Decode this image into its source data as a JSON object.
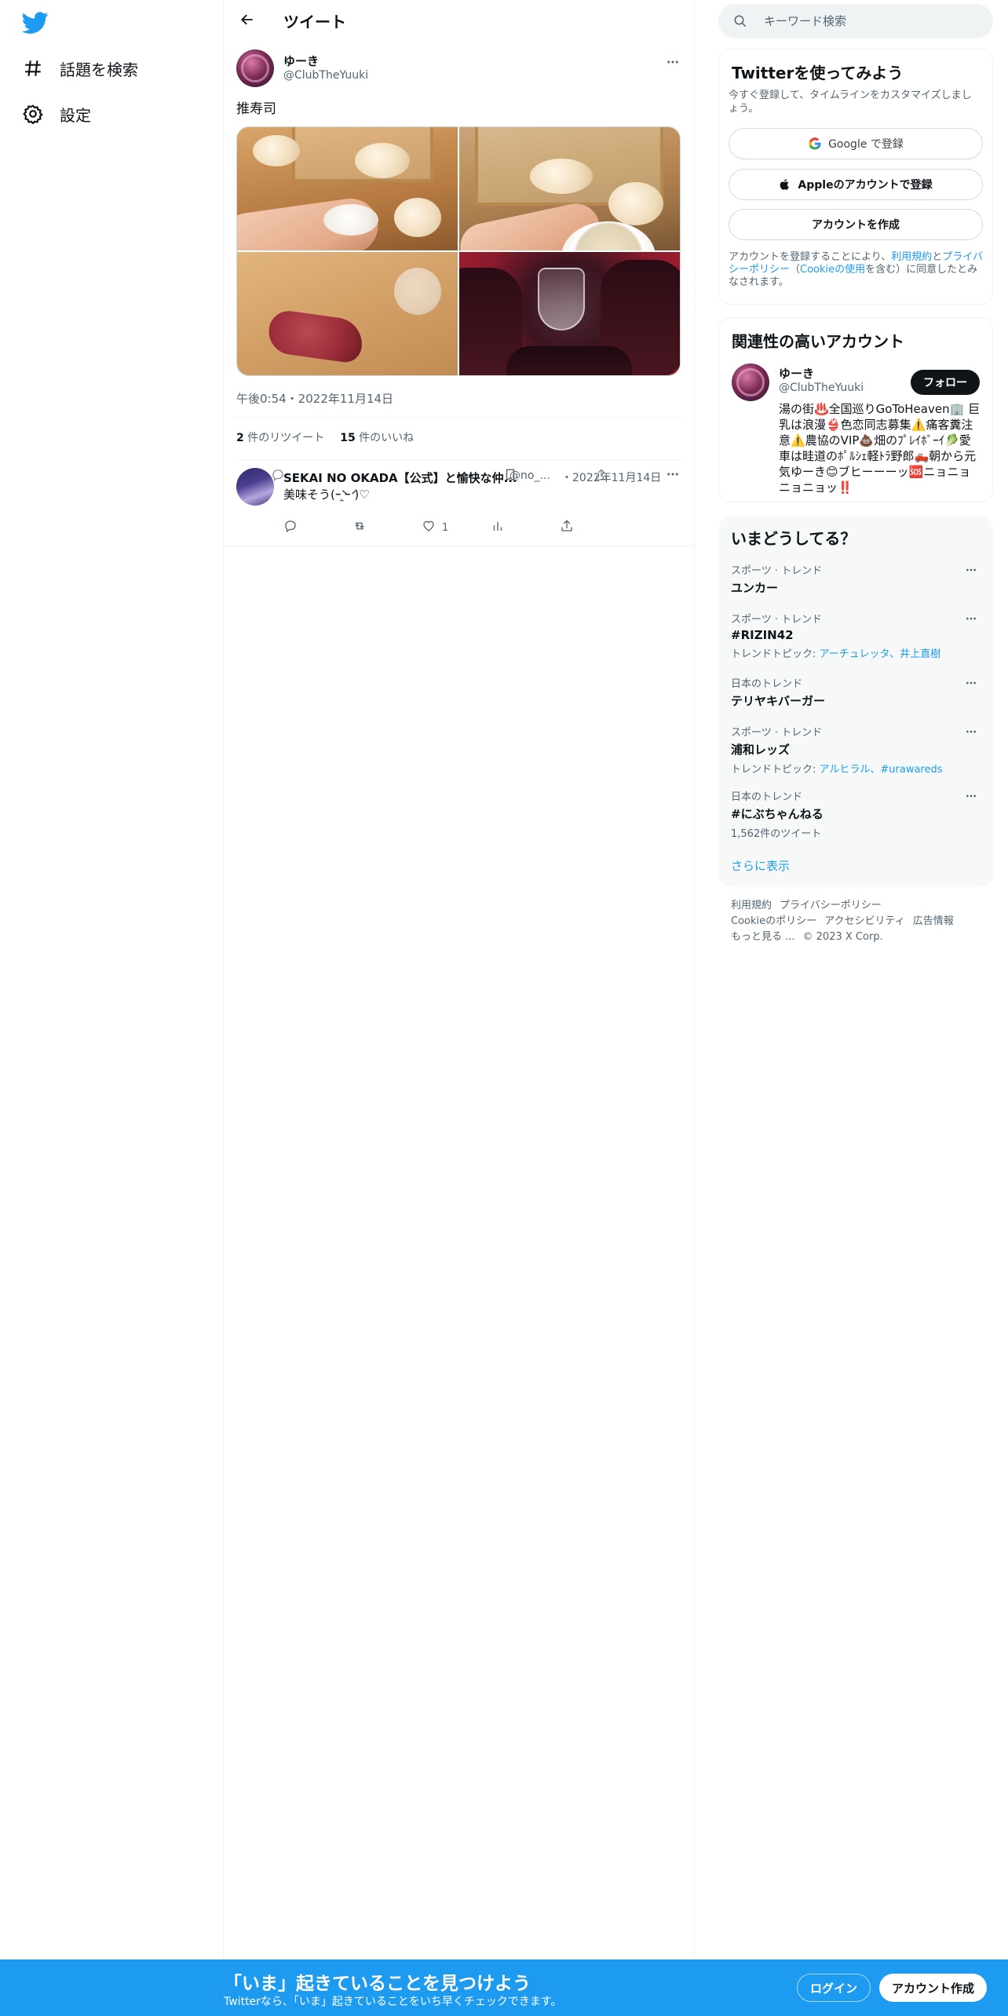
{
  "nav": {
    "explore_label": "話題を検索",
    "settings_label": "設定"
  },
  "header": {
    "title": "ツイート"
  },
  "tweet": {
    "author_name": "ゆーき",
    "author_handle": "@ClubTheYuuki",
    "text": "推寿司",
    "timestamp": "午後0:54・2022年11月14日",
    "retweets_count": "2",
    "retweets_label": "件のリツイート",
    "likes_count": "15",
    "likes_label": "件のいいね"
  },
  "reply": {
    "name": "SEKAI NO OKADA【公式】と愉快な仲...",
    "handle": "@no_...",
    "date": "・2022年11月14日",
    "text": "美味そう(ｰ̀ ̯ｰ́ )♡",
    "likes": "1"
  },
  "search": {
    "placeholder": "キーワード検索"
  },
  "signup": {
    "title": "Twitterを使ってみよう",
    "subtitle": "今すぐ登録して、タイムラインをカスタマイズしましょう。",
    "google_label": "Google で登録",
    "apple_label": "Appleのアカウントで登録",
    "create_label": "アカウントを作成",
    "terms_prefix": "アカウントを登録することにより、",
    "terms_link": "利用規約",
    "terms_and": "と",
    "privacy_link": "プライバシーポリシー",
    "terms_paren_open": "（",
    "cookie_link": "Cookieの使用",
    "terms_suffix": "を含む）に同意したとみなされます。"
  },
  "related": {
    "title": "関連性の高いアカウント",
    "name": "ゆーき",
    "handle": "@ClubTheYuuki",
    "follow_label": "フォロー",
    "bio": "湯の街♨️全国巡りGoToHeaven🏢 巨乳は浪漫👙色恋同志募集⚠️痛客糞注意⚠️農協のVIP💩畑のﾌﾟﾚｲﾎﾞｰｲ🥬愛車は畦道のﾎﾟﾙｼｪ軽ﾄﾗ野郎🛻朝から元気ゆーき😊ブヒーーーッ🆘ニョニョニョニョッ‼️"
  },
  "trends": {
    "title": "いまどうしてる？",
    "items": [
      {
        "context": "スポーツ · トレンド",
        "topic": "ユンカー",
        "extra_prefix": "",
        "extra_links": ""
      },
      {
        "context": "スポーツ · トレンド",
        "topic": "#RIZIN42",
        "extra_prefix": "トレンドトピック: ",
        "extra_links": "アーチュレッタ、井上直樹"
      },
      {
        "context": "日本のトレンド",
        "topic": "テリヤキバーガー",
        "extra_prefix": "",
        "extra_links": ""
      },
      {
        "context": "スポーツ · トレンド",
        "topic": "浦和レッズ",
        "extra_prefix": "トレンドトピック: ",
        "extra_links": "アルヒラル、#urawareds"
      },
      {
        "context": "日本のトレンド",
        "topic": "#にぶちゃんねる",
        "extra_prefix": "1,562件のツイート",
        "extra_links": ""
      }
    ],
    "show_more": "さらに表示"
  },
  "footer": {
    "links": [
      "利用規約",
      "プライバシーポリシー",
      "Cookieのポリシー",
      "アクセシビリティ",
      "広告情報",
      "もっと見る ..."
    ],
    "copyright": "© 2023 X Corp."
  },
  "bottombar": {
    "title": "「いま」起きていることを見つけよう",
    "subtitle": "Twitterなら、「いま」起きていることをいち早くチェックできます。",
    "login_label": "ログイン",
    "signup_label": "アカウント作成"
  },
  "colors": {
    "accent": "#1d9bf0",
    "text": "#0f1419",
    "secondary": "#536471"
  }
}
